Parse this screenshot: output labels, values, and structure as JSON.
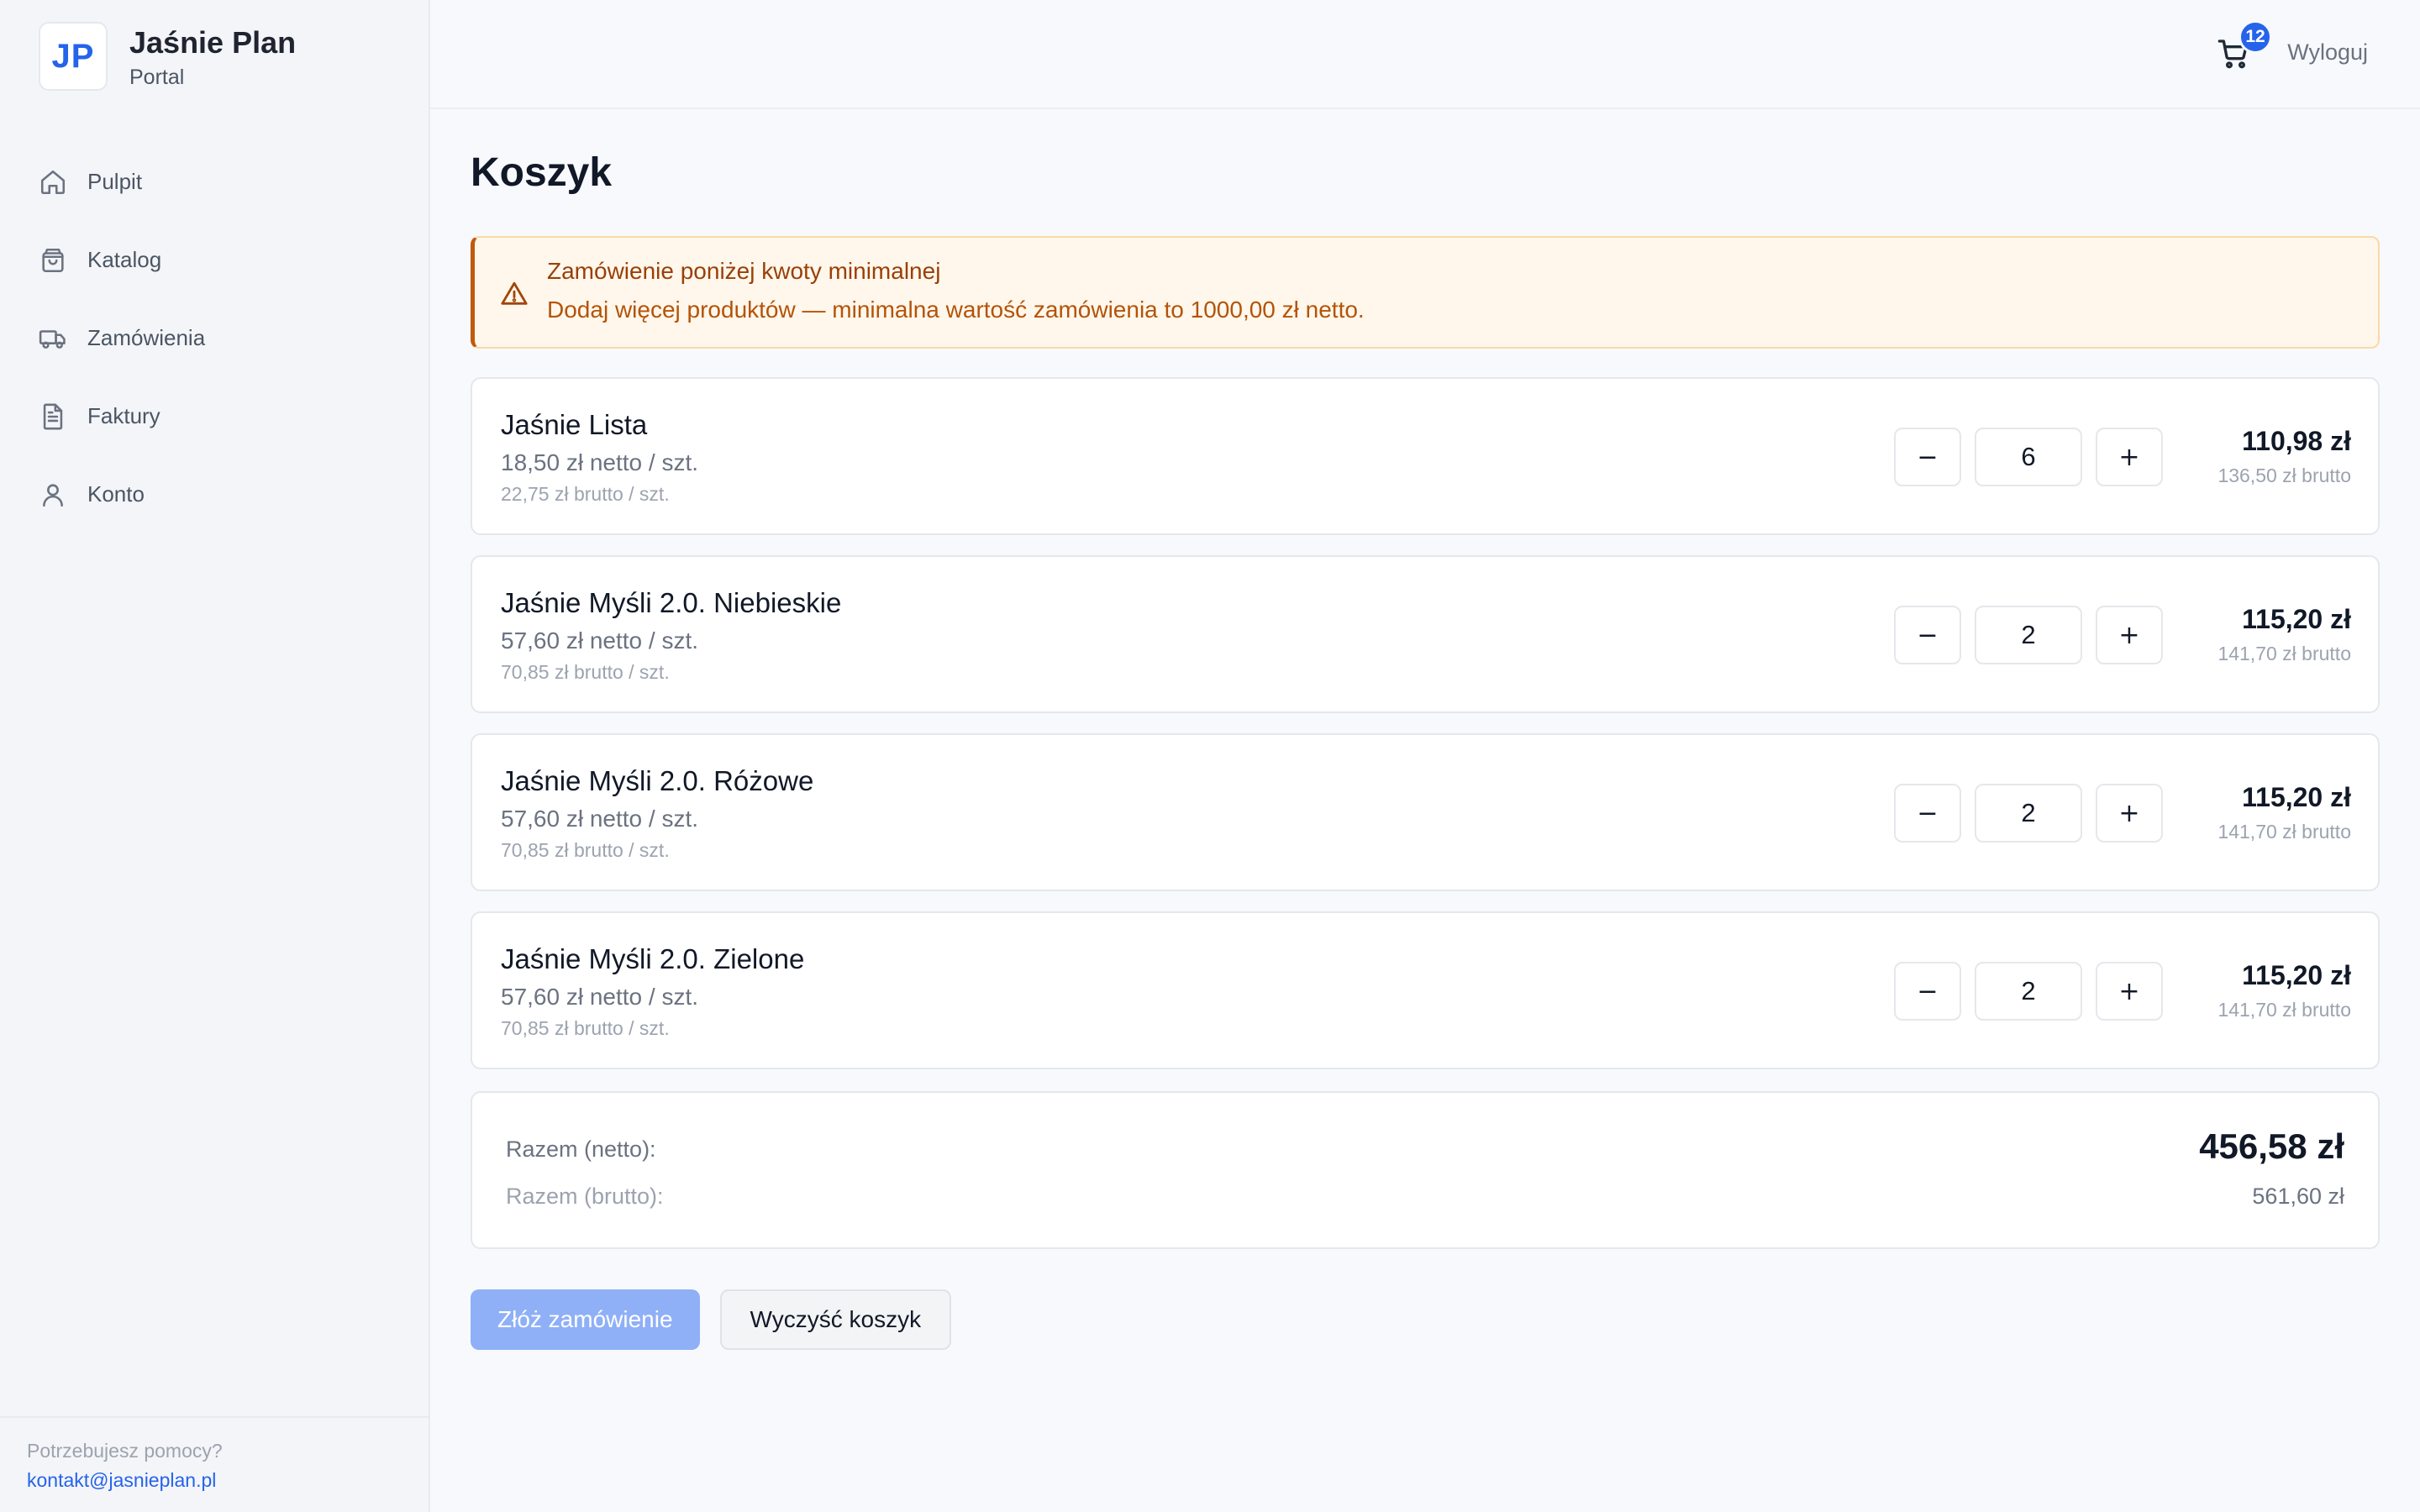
{
  "brand": {
    "logo": "JP",
    "title": "Jaśnie Plan",
    "subtitle": "Portal"
  },
  "sidebar": {
    "items": [
      {
        "label": "Pulpit",
        "icon": "home-icon"
      },
      {
        "label": "Katalog",
        "icon": "shopping-bag-icon"
      },
      {
        "label": "Zamówienia",
        "icon": "truck-icon"
      },
      {
        "label": "Faktury",
        "icon": "document-icon"
      },
      {
        "label": "Konto",
        "icon": "user-icon"
      }
    ],
    "help_text": "Potrzebujesz pomocy?",
    "help_email": "kontakt@jasnieplan.pl"
  },
  "header": {
    "cart_count": "12",
    "logout_label": "Wyloguj"
  },
  "page": {
    "title": "Koszyk"
  },
  "alert": {
    "title": "Zamówienie poniżej kwoty minimalnej",
    "message": "Dodaj więcej produktów — minimalna wartość zamówienia to 1000,00 zł netto."
  },
  "cart": {
    "items": [
      {
        "name": "Jaśnie Lista",
        "unit_net": "18,50 zł netto / szt.",
        "unit_gross": "22,75 zł brutto / szt.",
        "qty": "6",
        "total_net": "110,98 zł",
        "total_gross": "136,50 zł brutto"
      },
      {
        "name": "Jaśnie Myśli 2.0. Niebieskie",
        "unit_net": "57,60 zł netto / szt.",
        "unit_gross": "70,85 zł brutto / szt.",
        "qty": "2",
        "total_net": "115,20 zł",
        "total_gross": "141,70 zł brutto"
      },
      {
        "name": "Jaśnie Myśli 2.0. Różowe",
        "unit_net": "57,60 zł netto / szt.",
        "unit_gross": "70,85 zł brutto / szt.",
        "qty": "2",
        "total_net": "115,20 zł",
        "total_gross": "141,70 zł brutto"
      },
      {
        "name": "Jaśnie Myśli 2.0. Zielone",
        "unit_net": "57,60 zł netto / szt.",
        "unit_gross": "70,85 zł brutto / szt.",
        "qty": "2",
        "total_net": "115,20 zł",
        "total_gross": "141,70 zł brutto"
      }
    ],
    "minus_label": "−",
    "plus_label": "+"
  },
  "summary": {
    "net_label": "Razem (netto):",
    "gross_label": "Razem (brutto):",
    "net_value": "456,58 zł",
    "gross_value": "561,60 zł"
  },
  "actions": {
    "submit_label": "Złóż zamówienie",
    "clear_label": "Wyczyść koszyk"
  },
  "colors": {
    "accent": "#2563eb",
    "warning_bg": "#fff7eb",
    "warning_text": "#b45309",
    "primary_disabled": "#8fb0f7"
  }
}
